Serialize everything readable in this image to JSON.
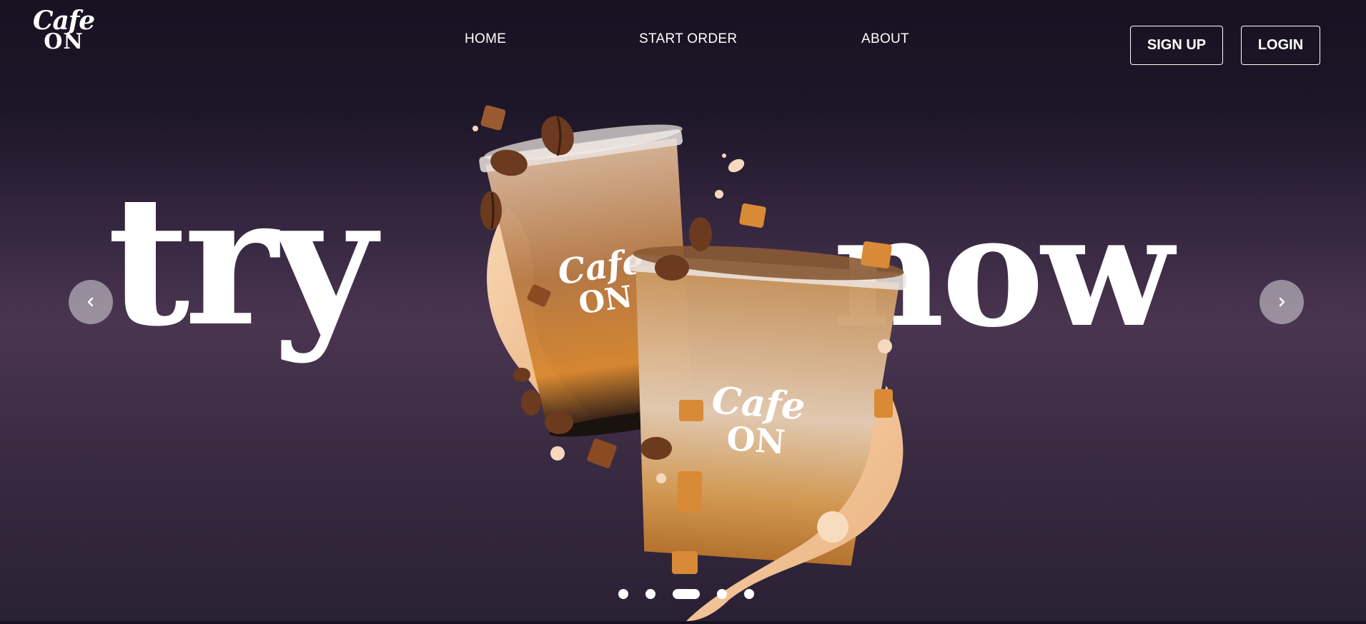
{
  "brand": {
    "logo_line1": "Cafe",
    "logo_line2": "ON"
  },
  "nav": {
    "items": [
      "HOME",
      "START ORDER",
      "ABOUT"
    ]
  },
  "auth": {
    "signup_label": "SIGN UP",
    "login_label": "LOGIN"
  },
  "hero": {
    "word_left": "try",
    "word_right": "now",
    "cup_logo_line1": "Cafe",
    "cup_logo_line2": "ON"
  },
  "carousel": {
    "prev_icon": "chevron-left-icon",
    "next_icon": "chevron-right-icon",
    "slide_count": 5,
    "active_slide": 3
  },
  "colors": {
    "background_top": "#171222",
    "background_mid": "#4a3550",
    "text": "#ffffff",
    "coffee": "#6b3a1f",
    "caramel": "#d98a3a",
    "cream": "#f2c9a0"
  }
}
